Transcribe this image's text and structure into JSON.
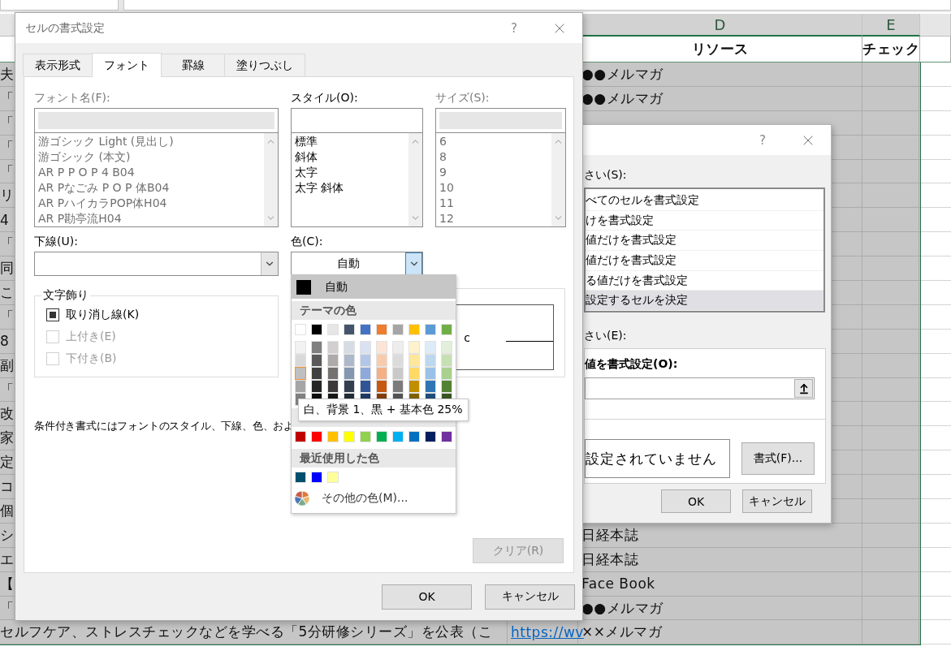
{
  "sheet": {
    "column_headers": [
      {
        "label": "D",
        "selected": true
      },
      {
        "label": "E",
        "selected": true
      }
    ],
    "header_row": {
      "resource": "リソース",
      "check": "チェック"
    },
    "rows": [
      {
        "col_b": "夫",
        "col_d": "●●メルマガ"
      },
      {
        "col_b": "「",
        "col_d": "●●メルマガ"
      },
      {
        "col_b": "「"
      },
      {
        "col_b": "「"
      },
      {
        "col_b": "「"
      },
      {
        "col_b": "リ"
      },
      {
        "col_b": "4"
      },
      {
        "col_b": "「"
      },
      {
        "col_b": "同"
      },
      {
        "col_b": "こ"
      },
      {
        "col_b": "「"
      },
      {
        "col_b": "8"
      },
      {
        "col_b": "副"
      },
      {
        "col_b": "「"
      },
      {
        "col_b": "改"
      },
      {
        "col_b": "家"
      },
      {
        "col_b": "定"
      },
      {
        "col_b": "コ"
      },
      {
        "col_b": "個"
      },
      {
        "col_b": "シ",
        "col_d": "日経本誌"
      },
      {
        "col_b": "エ",
        "col_d": "日経本誌"
      },
      {
        "col_b": "【",
        "col_d": "Face Book"
      },
      {
        "col_b": "「",
        "col_d": "●●メルマガ"
      },
      {
        "col_b": "セルフケア、ストレスチェックなどを学べる「5分研修シリーズ」を公表（こ",
        "col_c_link": "https://wv",
        "col_d": "××メルマガ"
      }
    ]
  },
  "rule_dialog": {
    "help": "?",
    "rule_type_label": "さい(S):",
    "rule_types": [
      {
        "label": "べてのセルを書式設定",
        "selected": false
      },
      {
        "label": "けを書式設定",
        "selected": false
      },
      {
        "label": "値だけを書式設定",
        "selected": false
      },
      {
        "label": "値だけを書式設定",
        "selected": false
      },
      {
        "label": "る値だけを書式設定",
        "selected": false
      },
      {
        "label": "設定するセルを決定",
        "selected": true
      }
    ],
    "edit_label": "さい(E):",
    "formula_label": "値を書式設定(O):",
    "preview": "設定されていません",
    "format_button": "書式(F)...",
    "buttons": [
      "OK",
      "キャンセル"
    ]
  },
  "font_dialog": {
    "title": "セルの書式設定",
    "help": "?",
    "tabs": [
      {
        "label": "表示形式",
        "selected": false
      },
      {
        "label": "フォント",
        "selected": true
      },
      {
        "label": "罫線",
        "selected": false
      },
      {
        "label": "塗りつぶし",
        "selected": false
      }
    ],
    "lists": [
      {
        "label": "フォント名(F):",
        "disabled": true,
        "items": [
          "游ゴシック Light (見出し)",
          "游ゴシック (本文)",
          "AR P P O P 4 B04",
          "AR Pなごみ P O P 体B04",
          "AR PハイカラPOP体H04",
          "AR P勘亭流H04"
        ]
      },
      {
        "label": "スタイル(O):",
        "disabled": false,
        "items": [
          "標準",
          "斜体",
          "太字",
          "太字 斜体"
        ]
      },
      {
        "label": "サイズ(S):",
        "disabled": true,
        "items": [
          "6",
          "8",
          "9",
          "10",
          "11",
          "12"
        ]
      }
    ],
    "underline": {
      "label": "下線(U):"
    },
    "color": {
      "label": "色(C):",
      "value": "自動",
      "open": true
    },
    "effects": {
      "title": "文字飾り",
      "options": [
        {
          "label": "取り消し線(K)",
          "checked": true,
          "disabled": false
        },
        {
          "label": "上付き(E)",
          "checked": false,
          "disabled": true
        },
        {
          "label": "下付き(B)",
          "checked": false,
          "disabled": true
        }
      ]
    },
    "preview": {
      "sample": "c"
    },
    "note": "条件付き書式にはフォントのスタイル、下線、色、およ",
    "clear_button": {
      "label": "クリア(R)",
      "disabled": true
    },
    "buttons": [
      "OK",
      "キャンセル"
    ]
  },
  "color_menu": {
    "automatic": {
      "label": "自動",
      "color": "#000000"
    },
    "theme_title": "テーマの色",
    "theme": [
      {
        "color": "#ffffff",
        "shades": [
          {
            "color": "#f2f2f2",
            "selected": false
          },
          {
            "color": "#d9d9d9",
            "selected": false
          },
          {
            "color": "#bfbfbf",
            "selected": true
          },
          {
            "color": "#a6a6a6",
            "selected": false
          },
          {
            "color": "#808080",
            "selected": false
          }
        ]
      },
      {
        "color": "#000000",
        "shades": [
          {
            "color": "#7f7f7f",
            "selected": false
          },
          {
            "color": "#595959",
            "selected": false
          },
          {
            "color": "#404040",
            "selected": false
          },
          {
            "color": "#262626",
            "selected": false
          },
          {
            "color": "#0d0d0d",
            "selected": false
          }
        ]
      },
      {
        "color": "#e7e6e6",
        "shades": [
          {
            "color": "#d0cece",
            "selected": false
          },
          {
            "color": "#aeaaaa",
            "selected": false
          },
          {
            "color": "#757171",
            "selected": false
          },
          {
            "color": "#3a3838",
            "selected": false
          },
          {
            "color": "#161616",
            "selected": false
          }
        ]
      },
      {
        "color": "#44546a",
        "shades": [
          {
            "color": "#d6dce4",
            "selected": false
          },
          {
            "color": "#adb9ca",
            "selected": false
          },
          {
            "color": "#8497b0",
            "selected": false
          },
          {
            "color": "#333f4f",
            "selected": false
          },
          {
            "color": "#222b35",
            "selected": false
          }
        ]
      },
      {
        "color": "#4472c4",
        "shades": [
          {
            "color": "#d9e1f2",
            "selected": false
          },
          {
            "color": "#b4c6e7",
            "selected": false
          },
          {
            "color": "#8ea9db",
            "selected": false
          },
          {
            "color": "#305496",
            "selected": false
          },
          {
            "color": "#203764",
            "selected": false
          }
        ]
      },
      {
        "color": "#ed7d31",
        "shades": [
          {
            "color": "#fce4d6",
            "selected": false
          },
          {
            "color": "#f8cbad",
            "selected": false
          },
          {
            "color": "#f4b084",
            "selected": false
          },
          {
            "color": "#c65911",
            "selected": false
          },
          {
            "color": "#833c0c",
            "selected": false
          }
        ]
      },
      {
        "color": "#a5a5a5",
        "shades": [
          {
            "color": "#ededed",
            "selected": false
          },
          {
            "color": "#dbdbdb",
            "selected": false
          },
          {
            "color": "#c9c9c9",
            "selected": false
          },
          {
            "color": "#7b7b7b",
            "selected": false
          },
          {
            "color": "#525252",
            "selected": false
          }
        ]
      },
      {
        "color": "#ffc000",
        "shades": [
          {
            "color": "#fff2cc",
            "selected": false
          },
          {
            "color": "#ffe699",
            "selected": false
          },
          {
            "color": "#ffd966",
            "selected": false
          },
          {
            "color": "#bf8f00",
            "selected": false
          },
          {
            "color": "#806000",
            "selected": false
          }
        ]
      },
      {
        "color": "#5b9bd5",
        "shades": [
          {
            "color": "#ddebf7",
            "selected": false
          },
          {
            "color": "#bdd7ee",
            "selected": false
          },
          {
            "color": "#9bc2e6",
            "selected": false
          },
          {
            "color": "#2f75b5",
            "selected": false
          },
          {
            "color": "#1f4e78",
            "selected": false
          }
        ]
      },
      {
        "color": "#70ad47",
        "shades": [
          {
            "color": "#e2efda",
            "selected": false
          },
          {
            "color": "#c6e0b4",
            "selected": false
          },
          {
            "color": "#a9d08e",
            "selected": false
          },
          {
            "color": "#548235",
            "selected": false
          },
          {
            "color": "#375623",
            "selected": false
          }
        ]
      }
    ],
    "tooltip": "白、背景 1、黒 + 基本色 25%",
    "standard": [
      {
        "color": "#c00000"
      },
      {
        "color": "#ff0000"
      },
      {
        "color": "#ffc000"
      },
      {
        "color": "#ffff00"
      },
      {
        "color": "#92d050"
      },
      {
        "color": "#00b050"
      },
      {
        "color": "#00b0f0"
      },
      {
        "color": "#0070c0"
      },
      {
        "color": "#002060"
      },
      {
        "color": "#7030a0"
      }
    ],
    "recent_title": "最近使用した色",
    "recent": [
      {
        "color": "#004f6e"
      },
      {
        "color": "#0000ff"
      },
      {
        "color": "#ffff99"
      }
    ],
    "more": "その他の色(M)..."
  }
}
